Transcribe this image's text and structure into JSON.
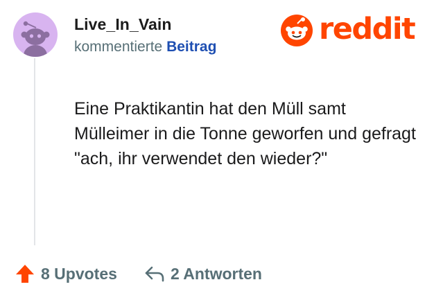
{
  "comment": {
    "username": "Live_In_Vain",
    "action_text": "kommentierte",
    "action_link": "Beitrag",
    "body": "Eine Praktikantin hat den Müll samt Mülleimer in die Tonne geworfen und gefragt \"ach, ihr verwendet den wieder?\""
  },
  "brand": {
    "wordmark": "reddit",
    "color": "#ff4500"
  },
  "footer": {
    "upvotes_label": "8 Upvotes",
    "replies_label": "2 Antworten"
  },
  "icons": {
    "avatar": "snoo-avatar-icon",
    "logo": "reddit-snoo-icon",
    "upvote": "upvote-arrow-icon",
    "reply": "reply-arrow-icon"
  },
  "colors": {
    "avatar_bg": "#d8b4f0",
    "avatar_figure": "#8c6fa0",
    "upvote": "#ff4500",
    "muted_text": "#576f76",
    "link": "#1e4fb2"
  }
}
